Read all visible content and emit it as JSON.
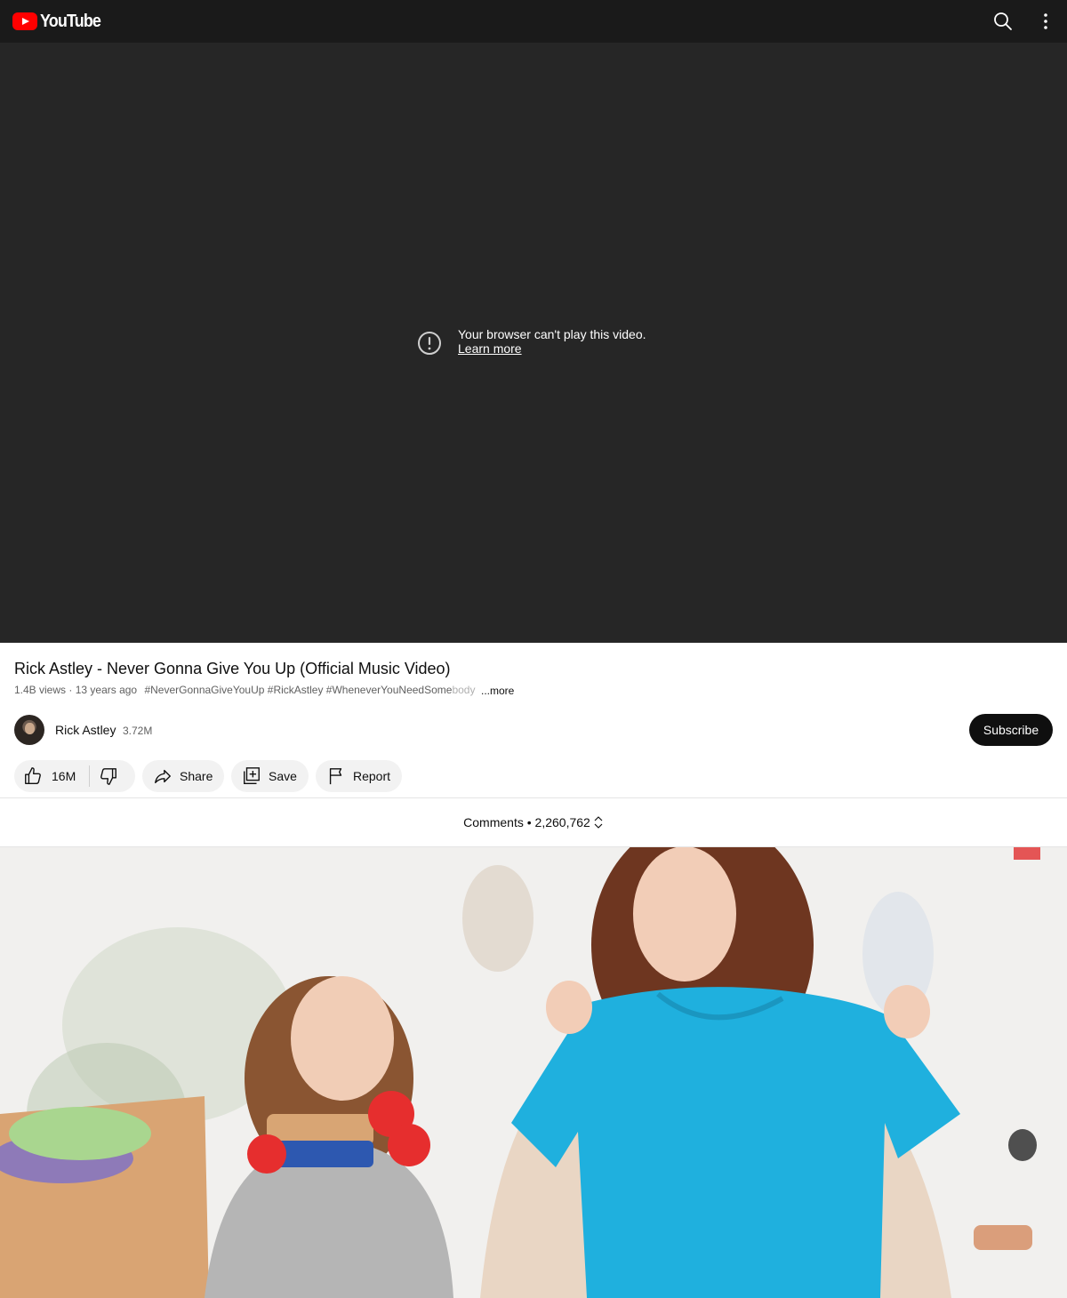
{
  "header": {
    "logo_text": "YouTube",
    "logo_icon": "youtube-logo-icon",
    "search_icon": "search-icon",
    "more_icon": "more-vert-icon",
    "background": "#1a1a1a"
  },
  "player": {
    "error_message": "Your browser can't play this video.",
    "learn_more": "Learn more",
    "error_icon": "alert-circle-icon",
    "background": "#262626"
  },
  "video": {
    "title": "Rick Astley - Never Gonna Give You Up (Official Music Video)",
    "views": "1.4B views",
    "age": "13 years ago",
    "hashtags": "#NeverGonnaGiveYouUp #RickAstley #WheneverYouNeedSome",
    "hashtags_faded": "body",
    "more_label": "...more"
  },
  "channel": {
    "name": "Rick Astley",
    "subscribers": "3.72M",
    "subscribe_label": "Subscribe"
  },
  "actions": {
    "likes": "16M",
    "share_label": "Share",
    "save_label": "Save",
    "report_label": "Report"
  },
  "comments": {
    "label": "Comments",
    "separator": "•",
    "count": "2,260,762"
  },
  "colors": {
    "brand_red": "#ff0000",
    "subscribe_bg": "#0f0f0f",
    "pill_bg": "#f2f2f2",
    "meta_text": "#606060"
  }
}
